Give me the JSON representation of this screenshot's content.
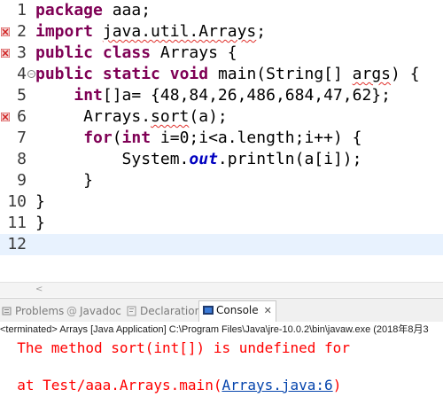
{
  "editor": {
    "lines": [
      {
        "n": "1",
        "parts": [
          {
            "t": "package",
            "k": "kw"
          },
          {
            "t": " aaa;"
          }
        ]
      },
      {
        "n": "2",
        "parts": [
          {
            "t": "import",
            "k": "kw"
          },
          {
            "t": " "
          },
          {
            "t": "java.util.Arrays",
            "k": "squiggle"
          },
          {
            "t": ";"
          }
        ]
      },
      {
        "n": "3",
        "parts": [
          {
            "t": "public",
            "k": "kw"
          },
          {
            "t": " "
          },
          {
            "t": "class",
            "k": "kw"
          },
          {
            "t": " Arrays {"
          }
        ]
      },
      {
        "n": "4",
        "parts": [
          {
            "t": "public",
            "k": "kw"
          },
          {
            "t": " "
          },
          {
            "t": "static",
            "k": "kw"
          },
          {
            "t": " "
          },
          {
            "t": "void",
            "k": "kw"
          },
          {
            "t": " main(String[] "
          },
          {
            "t": "args",
            "k": "squiggle"
          },
          {
            "t": ") {"
          }
        ]
      },
      {
        "n": "5",
        "parts": [
          {
            "t": "    "
          },
          {
            "t": "int",
            "k": "kw"
          },
          {
            "t": "[]a= {48,84,26,486,684,47,62};"
          }
        ]
      },
      {
        "n": "6",
        "parts": [
          {
            "t": "     Arrays."
          },
          {
            "t": "sort",
            "k": "squiggle"
          },
          {
            "t": "(a);"
          }
        ]
      },
      {
        "n": "7",
        "parts": [
          {
            "t": "     "
          },
          {
            "t": "for",
            "k": "kw"
          },
          {
            "t": "("
          },
          {
            "t": "int",
            "k": "kw"
          },
          {
            "t": " i=0;i<a.length;i++) {"
          }
        ]
      },
      {
        "n": "8",
        "parts": [
          {
            "t": "         System."
          },
          {
            "t": "out",
            "k": "static-field"
          },
          {
            "t": ".println(a[i]);"
          }
        ]
      },
      {
        "n": "9",
        "parts": [
          {
            "t": "     }"
          }
        ]
      },
      {
        "n": "10",
        "parts": [
          {
            "t": "}"
          }
        ]
      },
      {
        "n": "11",
        "parts": [
          {
            "t": "}"
          }
        ]
      },
      {
        "n": "12",
        "parts": [
          {
            "t": ""
          }
        ]
      }
    ]
  },
  "panel": {
    "tabs": [
      {
        "id": "problems",
        "label": "Problems",
        "icon": "problems-icon"
      },
      {
        "id": "javadoc",
        "label": "Javadoc",
        "icon": "at-sign-icon"
      },
      {
        "id": "declaration",
        "label": "Declaration",
        "icon": "declaration-icon"
      },
      {
        "id": "console",
        "label": "Console",
        "icon": "console-icon",
        "active": true
      }
    ],
    "close_glyph": "✕"
  },
  "console": {
    "status": "<terminated> Arrays [Java Application] C:\\Program Files\\Java\\jre-10.0.2\\bin\\javaw.exe (2018年8月3",
    "error_line": "  The method sort(int[]) is undefined for",
    "trace_prefix": "  at Test/aaa.Arrays.main(",
    "trace_link": "Arrays.java:6",
    "trace_suffix": ")"
  },
  "colors": {
    "keyword": "#7f0055",
    "error_text": "#ff0000",
    "link": "#0645ad",
    "current_line": "#e8f2fe"
  }
}
